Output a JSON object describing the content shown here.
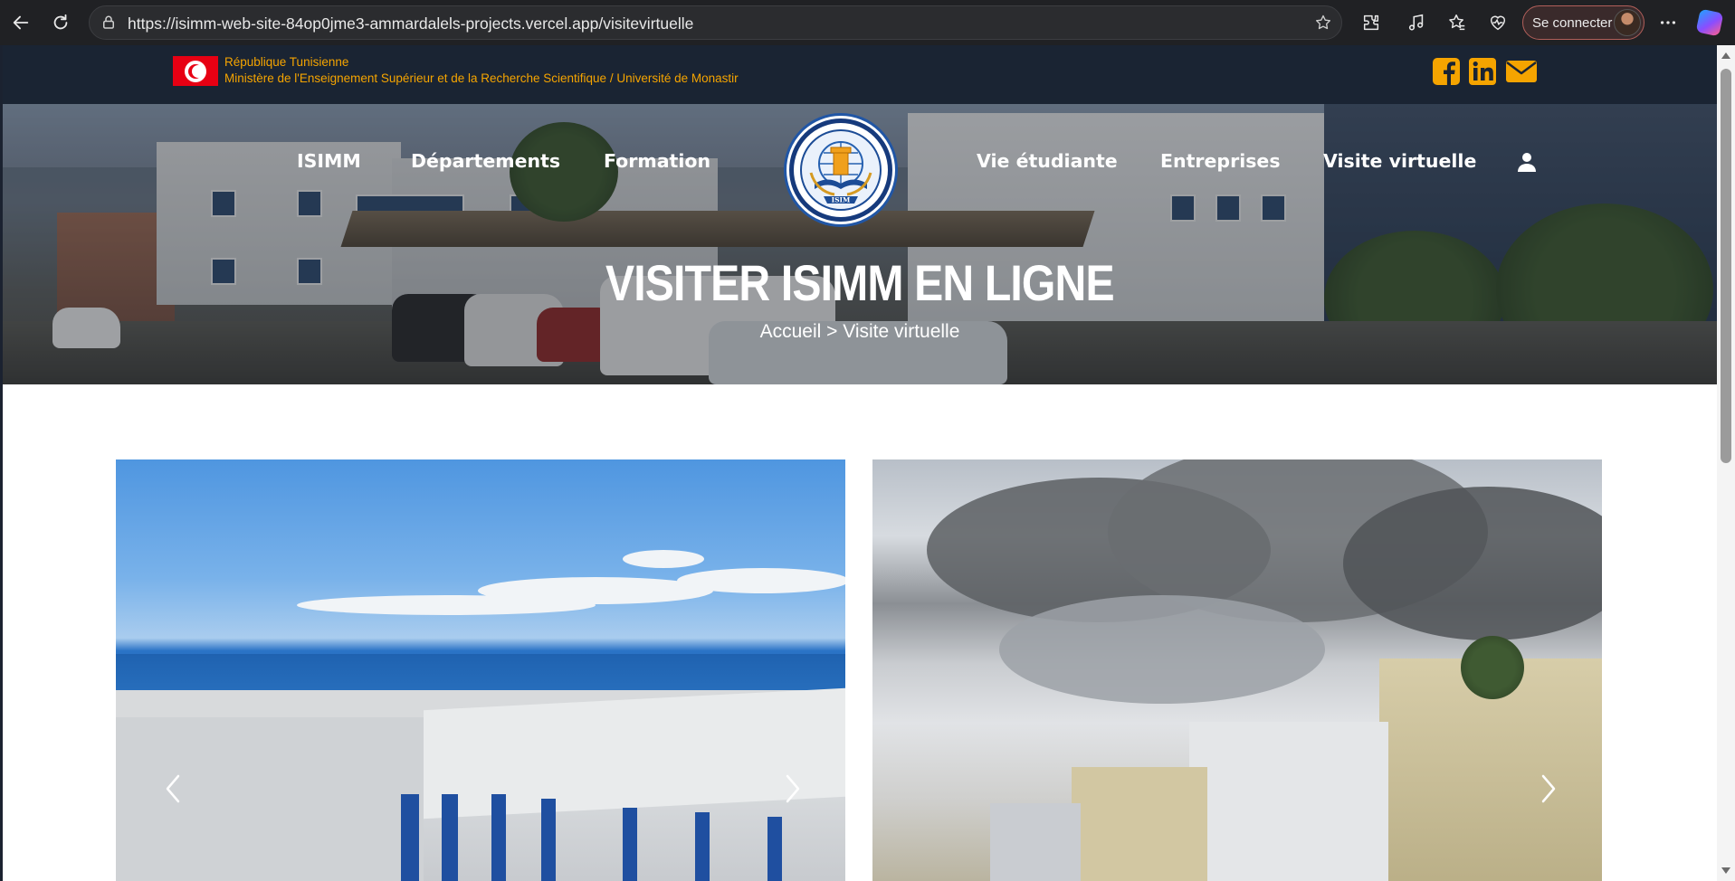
{
  "browser": {
    "url": "https://isimm-web-site-84op0jme3-ammardalels-projects.vercel.app/visitevirtuelle",
    "sign_in_label": "Se connecter"
  },
  "topbar": {
    "line1": "République Tunisienne",
    "line2": "Ministère de l'Enseignement Supérieur et de la Recherche Scientifique / Université de Monastir",
    "social_icons": [
      "facebook-icon",
      "linkedin-icon",
      "envelope-icon"
    ],
    "accent_color": "#f5a400",
    "bg_color": "#1a2433"
  },
  "nav": {
    "items": [
      "ISIMM",
      "Départements",
      "Formation",
      "Vie étudiante",
      "Entreprises",
      "Visite virtuelle"
    ],
    "logo_text": "ISIM"
  },
  "hero": {
    "title": "VISITER ISIMM EN LIGNE",
    "breadcrumb": "Accueil > Visite virtuelle"
  },
  "gallery": {
    "cards": [
      {
        "name": "sea-view-photo",
        "prev": "‹",
        "next": "›"
      },
      {
        "name": "building-entrance-photo",
        "next": "›"
      }
    ]
  }
}
